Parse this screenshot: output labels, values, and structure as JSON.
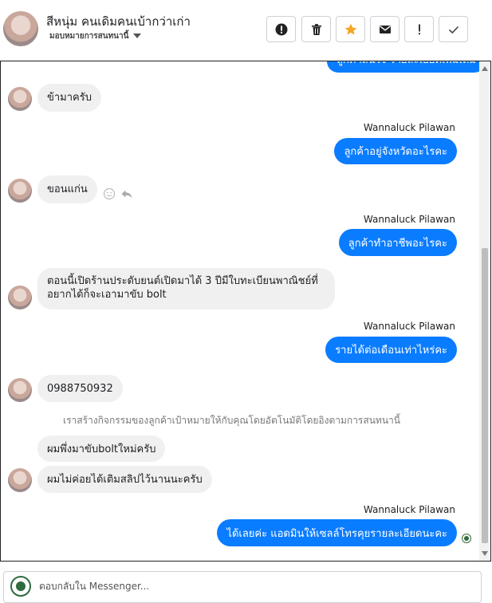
{
  "header": {
    "contact_name": "สีหนุ่ม คนเดิมคนเบ้ากว่าเก่า",
    "assign_label": "มอบหมายการสนทนานี้",
    "toolbar": [
      {
        "name": "spam-button",
        "icon": "alert-circle-icon"
      },
      {
        "name": "delete-button",
        "icon": "trash-icon"
      },
      {
        "name": "star-button",
        "icon": "star-icon"
      },
      {
        "name": "mark-unread-button",
        "icon": "envelope-icon"
      },
      {
        "name": "priority-button",
        "icon": "exclamation-icon"
      },
      {
        "name": "done-button",
        "icon": "checkmark-icon"
      }
    ]
  },
  "thread": {
    "partial_top": "ลูกค้าสนใจ รายละเอียดเพิ่มเติม",
    "messages": [
      {
        "from": "customer",
        "text": "ข้ามาครับ"
      },
      {
        "from": "page",
        "sender": "Wannaluck Pilawan",
        "text": "ลูกค้าอยู่จังหวัดอะไรคะ"
      },
      {
        "from": "customer",
        "text": "ขอนแก่น"
      },
      {
        "from": "page",
        "sender": "Wannaluck Pilawan",
        "text": "ลูกค้าทำอาชีพอะไรคะ"
      },
      {
        "from": "customer",
        "text": "ตอนนี้เปิดร้านประดับยนต์เปิดมาได้ 3 ปีมีใบทะเบียนพาณิชย์ที่",
        "text2": "อยากได้ก็จะเอามาขับ bolt"
      },
      {
        "from": "page",
        "sender": "Wannaluck Pilawan",
        "text": "รายได้ต่อเดือนเท่าไหร่คะ"
      },
      {
        "from": "customer",
        "text": "0988750932"
      },
      {
        "from": "system",
        "text": "เราสร้างกิจกรรมของลูกค้าเป้าหมายให้กับคุณโดยอัตโนมัติโดยอิงตามการสนทนานี้"
      },
      {
        "from": "customer",
        "text": "ผมพึ่งมาขับboltใหม่ครับ"
      },
      {
        "from": "customer",
        "text": "ผมไม่ค่อยได้เติมสลิปไว้นานนะครับ"
      },
      {
        "from": "page",
        "sender": "Wannaluck Pilawan",
        "text": "ได้เลยค่ะ  แอดมินให้เซลล์โทรคุยรายละเอียดนะคะ"
      }
    ]
  },
  "composer": {
    "placeholder": "ตอบกลับใน Messenger..."
  },
  "colors": {
    "outgoing_bubble": "#0a7cff",
    "incoming_bubble": "#f0f0f0",
    "star": "#f5a623"
  }
}
